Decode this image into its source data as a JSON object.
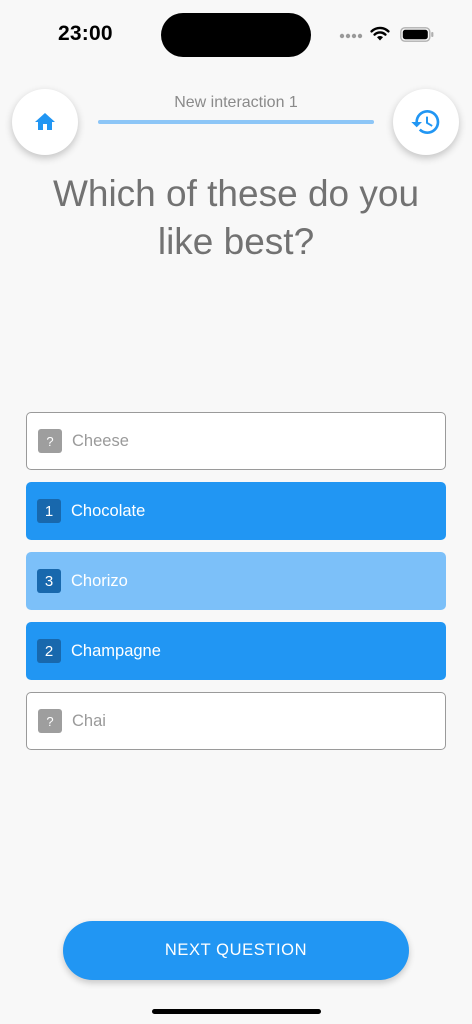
{
  "status_bar": {
    "time": "23:00",
    "icons": [
      "signal-dots-icon",
      "wifi-icon",
      "battery-icon"
    ]
  },
  "header": {
    "home_icon": "home-icon",
    "history_icon": "history-icon",
    "interaction_title": "New interaction 1",
    "progress_fraction": 1.0
  },
  "question": "Which of these do you like best?",
  "options": [
    {
      "label": "Cheese",
      "rank": "?",
      "state": "unranked"
    },
    {
      "label": "Chocolate",
      "rank": "1",
      "state": "ranked"
    },
    {
      "label": "Chorizo",
      "rank": "3",
      "state": "ranked"
    },
    {
      "label": "Champagne",
      "rank": "2",
      "state": "ranked"
    },
    {
      "label": "Chai",
      "rank": "?",
      "state": "unranked"
    }
  ],
  "next_button_label": "NEXT QUESTION",
  "colors": {
    "accent": "#2196f3",
    "accent_light": "#7cc0f9",
    "badge_dark": "#1868ad",
    "unranked_badge": "#9e9e9e",
    "background": "#f8f8f8"
  }
}
